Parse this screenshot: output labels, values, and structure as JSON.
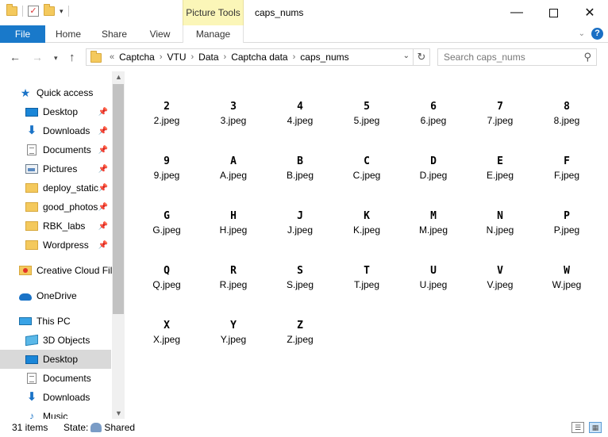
{
  "titlebar": {
    "context_tab": "Picture Tools",
    "title": "caps_nums",
    "minimize": "—",
    "close": "✕"
  },
  "ribbon": {
    "tabs": [
      "File",
      "Home",
      "Share",
      "View",
      "Manage"
    ],
    "collapse_chevron": "⌄",
    "help": "?"
  },
  "address": {
    "overflow": "«",
    "crumbs": [
      "Captcha",
      "VTU",
      "Data",
      "Captcha data",
      "caps_nums"
    ],
    "search_placeholder": "Search caps_nums"
  },
  "navpane": {
    "items": [
      {
        "label": "Quick access",
        "icon": "star-icon",
        "indent": 0,
        "pinned": false
      },
      {
        "label": "Desktop",
        "icon": "desktop-icon",
        "indent": 1,
        "pinned": true
      },
      {
        "label": "Downloads",
        "icon": "downloads-icon",
        "indent": 1,
        "pinned": true
      },
      {
        "label": "Documents",
        "icon": "documents-icon",
        "indent": 1,
        "pinned": true
      },
      {
        "label": "Pictures",
        "icon": "pictures-icon",
        "indent": 1,
        "pinned": true
      },
      {
        "label": "deploy_static",
        "icon": "folder-icon",
        "indent": 1,
        "pinned": true
      },
      {
        "label": "good_photos",
        "icon": "folder-icon",
        "indent": 1,
        "pinned": true
      },
      {
        "label": "RBK_labs",
        "icon": "folder-icon",
        "indent": 1,
        "pinned": true
      },
      {
        "label": "Wordpress",
        "icon": "folder-icon",
        "indent": 1,
        "pinned": true
      },
      {
        "label": "Creative Cloud Fil",
        "icon": "creative-cloud-icon",
        "indent": 0,
        "pinned": false
      },
      {
        "label": "OneDrive",
        "icon": "onedrive-icon",
        "indent": 0,
        "pinned": false
      },
      {
        "label": "This PC",
        "icon": "this-pc-icon",
        "indent": 0,
        "pinned": false
      },
      {
        "label": "3D Objects",
        "icon": "3d-objects-icon",
        "indent": 1,
        "pinned": false
      },
      {
        "label": "Desktop",
        "icon": "desktop-icon",
        "indent": 1,
        "pinned": false,
        "selected": true
      },
      {
        "label": "Documents",
        "icon": "documents-icon",
        "indent": 1,
        "pinned": false
      },
      {
        "label": "Downloads",
        "icon": "downloads-icon",
        "indent": 1,
        "pinned": false
      },
      {
        "label": "Music",
        "icon": "music-icon",
        "indent": 1,
        "pinned": false
      }
    ]
  },
  "files": [
    {
      "glyph": "2",
      "name": "2.jpeg"
    },
    {
      "glyph": "3",
      "name": "3.jpeg"
    },
    {
      "glyph": "4",
      "name": "4.jpeg"
    },
    {
      "glyph": "5",
      "name": "5.jpeg"
    },
    {
      "glyph": "6",
      "name": "6.jpeg"
    },
    {
      "glyph": "7",
      "name": "7.jpeg"
    },
    {
      "glyph": "8",
      "name": "8.jpeg"
    },
    {
      "glyph": "9",
      "name": "9.jpeg"
    },
    {
      "glyph": "A",
      "name": "A.jpeg"
    },
    {
      "glyph": "B",
      "name": "B.jpeg"
    },
    {
      "glyph": "C",
      "name": "C.jpeg"
    },
    {
      "glyph": "D",
      "name": "D.jpeg"
    },
    {
      "glyph": "E",
      "name": "E.jpeg"
    },
    {
      "glyph": "F",
      "name": "F.jpeg"
    },
    {
      "glyph": "G",
      "name": "G.jpeg"
    },
    {
      "glyph": "H",
      "name": "H.jpeg"
    },
    {
      "glyph": "J",
      "name": "J.jpeg"
    },
    {
      "glyph": "K",
      "name": "K.jpeg"
    },
    {
      "glyph": "M",
      "name": "M.jpeg"
    },
    {
      "glyph": "N",
      "name": "N.jpeg"
    },
    {
      "glyph": "P",
      "name": "P.jpeg"
    },
    {
      "glyph": "Q",
      "name": "Q.jpeg"
    },
    {
      "glyph": "R",
      "name": "R.jpeg"
    },
    {
      "glyph": "S",
      "name": "S.jpeg"
    },
    {
      "glyph": "T",
      "name": "T.jpeg"
    },
    {
      "glyph": "U",
      "name": "U.jpeg"
    },
    {
      "glyph": "V",
      "name": "V.jpeg"
    },
    {
      "glyph": "W",
      "name": "W.jpeg"
    },
    {
      "glyph": "X",
      "name": "X.jpeg"
    },
    {
      "glyph": "Y",
      "name": "Y.jpeg"
    },
    {
      "glyph": "Z",
      "name": "Z.jpeg"
    }
  ],
  "status": {
    "count": "31 items",
    "state_label": "State:",
    "state_value": "Shared"
  },
  "colors": {
    "file_tab": "#1979ca",
    "context_tab": "#fbf6b8",
    "selected_nav": "#d9d9d9"
  }
}
